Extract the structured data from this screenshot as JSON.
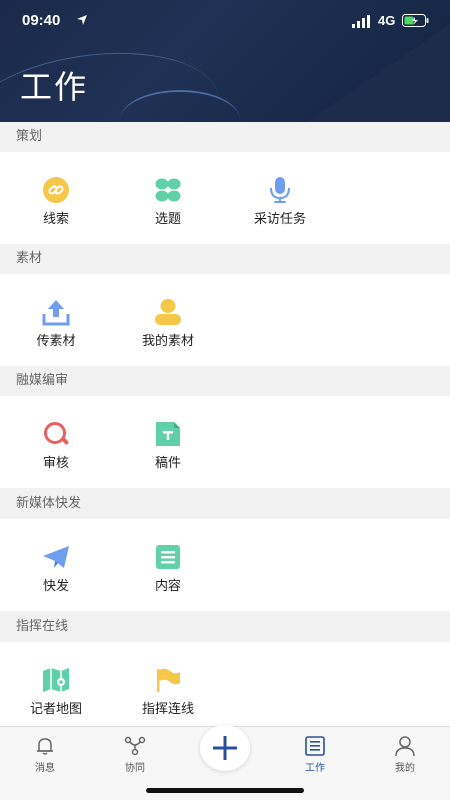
{
  "status": {
    "time": "09:40",
    "network": "4G"
  },
  "header": {
    "title": "工作"
  },
  "sections": [
    {
      "title": "策划",
      "items": [
        {
          "label": "线索",
          "icon": "link-icon"
        },
        {
          "label": "选题",
          "icon": "grid-icon"
        },
        {
          "label": "采访任务",
          "icon": "microphone-icon"
        }
      ]
    },
    {
      "title": "素材",
      "items": [
        {
          "label": "传素材",
          "icon": "upload-icon"
        },
        {
          "label": "我的素材",
          "icon": "user-icon"
        }
      ]
    },
    {
      "title": "融媒编审",
      "items": [
        {
          "label": "审核",
          "icon": "review-icon"
        },
        {
          "label": "稿件",
          "icon": "document-icon"
        }
      ]
    },
    {
      "title": "新媒体快发",
      "items": [
        {
          "label": "快发",
          "icon": "send-icon"
        },
        {
          "label": "内容",
          "icon": "content-icon"
        }
      ]
    },
    {
      "title": "指挥在线",
      "items": [
        {
          "label": "记者地图",
          "icon": "map-icon"
        },
        {
          "label": "指挥连线",
          "icon": "flag-icon"
        }
      ]
    }
  ],
  "tabbar": {
    "tabs": [
      {
        "label": "消息",
        "icon": "bell-icon"
      },
      {
        "label": "协同",
        "icon": "collaboration-icon"
      },
      {
        "label": "工作",
        "icon": "list-icon",
        "active": true
      },
      {
        "label": "我的",
        "icon": "profile-icon"
      }
    ],
    "add_icon": "plus-icon"
  },
  "colors": {
    "header_bg": "#1b2a4a",
    "accent_blue": "#2a4f9c",
    "yellow": "#f5c84a",
    "green": "#5fd0a8",
    "blue": "#6f9ef0",
    "red": "#e86060"
  }
}
